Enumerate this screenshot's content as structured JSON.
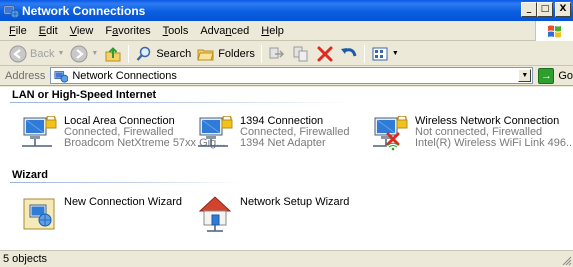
{
  "window": {
    "title": "Network Connections",
    "controls": {
      "minimize": "_",
      "maximize": "□",
      "close": "X"
    }
  },
  "menu": [
    {
      "pre": "",
      "key": "F",
      "post": "ile"
    },
    {
      "pre": "",
      "key": "E",
      "post": "dit"
    },
    {
      "pre": "",
      "key": "V",
      "post": "iew"
    },
    {
      "pre": "F",
      "key": "a",
      "post": "vorites"
    },
    {
      "pre": "",
      "key": "T",
      "post": "ools"
    },
    {
      "pre": "Adva",
      "key": "n",
      "post": "ced"
    },
    {
      "pre": "",
      "key": "H",
      "post": "elp"
    }
  ],
  "toolbar": {
    "back_label": "Back",
    "search_label": "Search",
    "folders_label": "Folders"
  },
  "address": {
    "label": "Address",
    "value": "Network Connections",
    "go_label": "Go"
  },
  "groups": {
    "lan": {
      "header": "LAN or High-Speed Internet",
      "items": [
        {
          "name": "Local Area Connection",
          "status": "Connected, Firewalled",
          "device": "Broadcom NetXtreme 57xx Gig..."
        },
        {
          "name": "1394 Connection",
          "status": "Connected, Firewalled",
          "device": "1394 Net Adapter"
        },
        {
          "name": "Wireless Network Connection",
          "status": "Not connected, Firewalled",
          "device": "Intel(R) Wireless WiFi Link 496..."
        }
      ]
    },
    "wizard": {
      "header": "Wizard",
      "items": [
        {
          "name": "New Connection Wizard"
        },
        {
          "name": "Network Setup Wizard"
        }
      ]
    }
  },
  "status": {
    "text": "5 objects"
  },
  "colors": {
    "titlebar": "#0a5ae6",
    "chrome": "#ece9d8",
    "content_bg": "#ffffff",
    "secondary_text": "#7a7a7a",
    "group_line": "#a0b4d8"
  },
  "icons": [
    "network-connections-icon",
    "back-icon",
    "forward-icon",
    "up-folder-icon",
    "search-icon",
    "folders-icon",
    "move-to-icon",
    "copy-to-icon",
    "delete-icon",
    "undo-icon",
    "views-icon",
    "go-icon",
    "lan-connection-icon",
    "firewall-lock-icon",
    "disconnected-x-icon",
    "wireless-icon",
    "wizard-icon",
    "home-network-icon",
    "windows-logo-icon",
    "size-grip-icon"
  ]
}
